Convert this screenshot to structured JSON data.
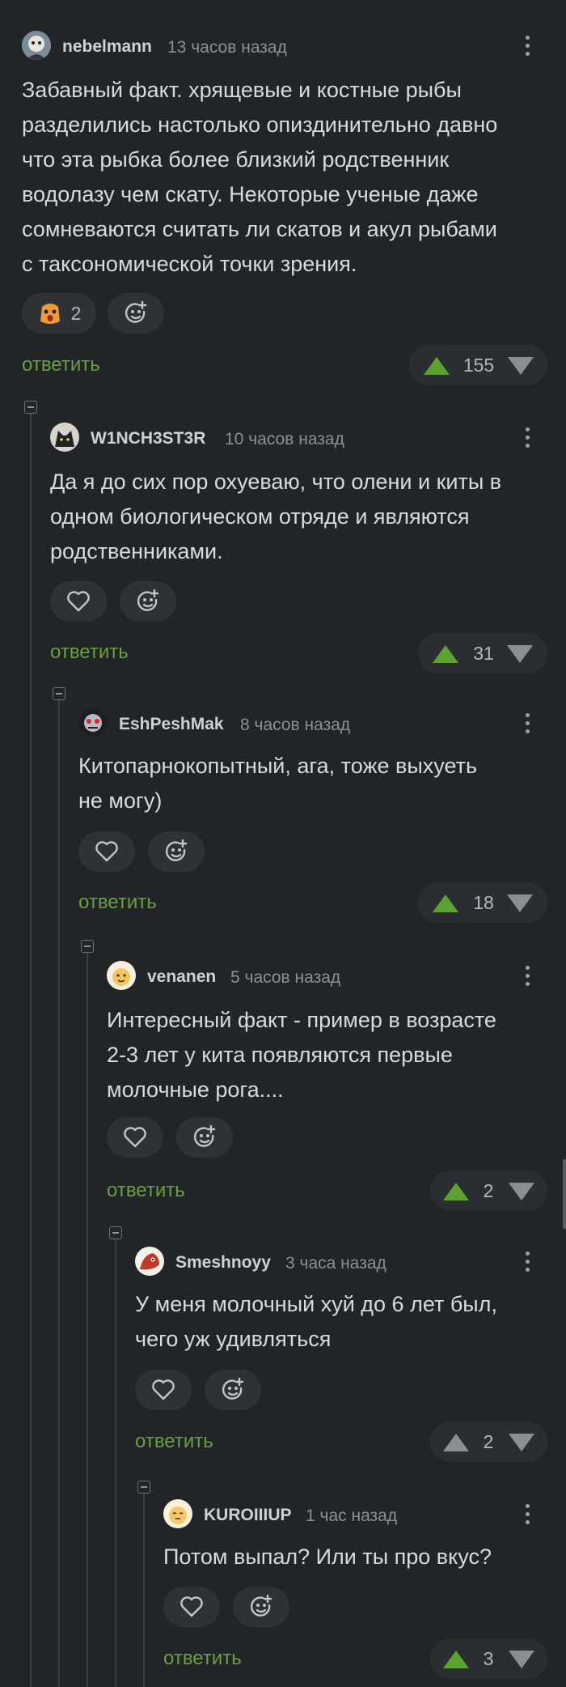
{
  "comments": [
    {
      "username": "nebelmann",
      "time": "13 часов назад",
      "text_lines": [
        "Забавный факт. хрящевые и костные рыбы",
        "разделились настолько опиздинительно давно",
        "что эта рыбка более близкий родственник",
        "водолазу чем скату. Некоторые ученые даже",
        "сомневаются считать ли скатов и акул рыбами",
        "с таксономической точки зрения."
      ],
      "reaction_count": "2",
      "reply_label": "ответить",
      "rating": "155"
    },
    {
      "username": "W1NCH3ST3R",
      "time": "10 часов назад",
      "text_lines": [
        "Да я до сих пор охуеваю, что олени и киты в",
        "одном биологическом отряде и являются",
        "родственниками."
      ],
      "reply_label": "ответить",
      "rating": "31"
    },
    {
      "username": "EshPeshMak",
      "time": "8 часов назад",
      "text_lines": [
        "Китопарнокопытный, ага, тоже выхуеть",
        "не могу)"
      ],
      "reply_label": "ответить",
      "rating": "18"
    },
    {
      "username": "venanen",
      "time": "5 часов назад",
      "text_lines": [
        "Интересный факт - пример в возрасте",
        "2-3 лет у кита появляются первые",
        "молочные рога...."
      ],
      "reply_label": "ответить",
      "rating": "2"
    },
    {
      "username": "Smeshnoyy",
      "time": "3 часа назад",
      "text_lines": [
        "У меня молочный хуй до 6 лет был,",
        "чего уж удивляться"
      ],
      "reply_label": "ответить",
      "rating": "2"
    },
    {
      "username": "KUROIIIUP",
      "time": "1 час назад",
      "text_lines": [
        "Потом выпал? Или ты про вкус?"
      ],
      "reply_label": "ответить",
      "rating": "3"
    }
  ],
  "icons": {
    "like": "heart-icon",
    "add_reaction": "add-reaction-icon",
    "upvote": "arrow-up-icon",
    "downvote": "arrow-down-icon",
    "more": "more-vertical-icon",
    "collapse": "collapse-icon"
  },
  "colors": {
    "background": "#222527",
    "reply_link": "#6a9e3f",
    "upvote_active": "#5da131",
    "upvote_inactive": "#8b8f93",
    "text": "#d9dadb",
    "meta": "#8b9095"
  }
}
